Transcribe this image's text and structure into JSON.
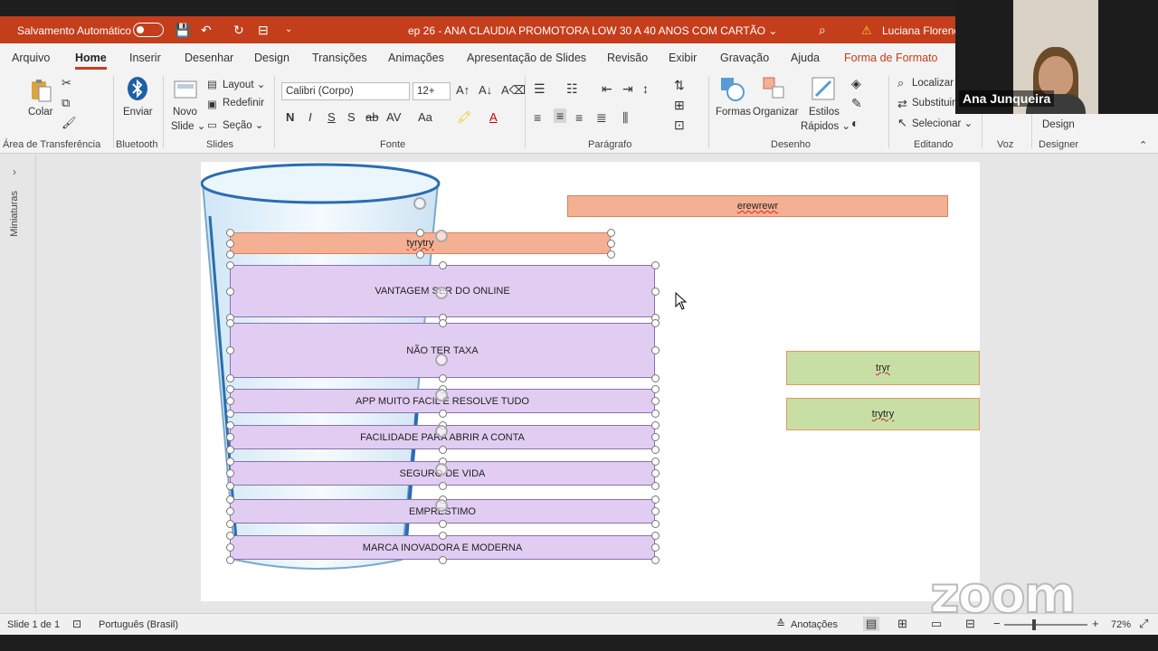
{
  "titlebar": {
    "autosave_label": "Salvamento Automático",
    "doc_title": "ep 26 - ANA CLAUDIA   PROMOTORA LOW  30 A 40 ANOS   COM CARTÃO  ⌄",
    "user_name": "Luciana Florenci"
  },
  "tabs": [
    "Arquivo",
    "Home",
    "Inserir",
    "Desenhar",
    "Design",
    "Transições",
    "Animações",
    "Apresentação de Slides",
    "Revisão",
    "Exibir",
    "Gravação",
    "Ajuda",
    "Forma de Formato"
  ],
  "ribbon": {
    "colar": "Colar",
    "enviar": "Enviar",
    "novo_slide": "Novo",
    "novo_slide2": "Slide ⌄",
    "layout": "Layout ⌄",
    "redefinir": "Redefinir",
    "secao": "Seção ⌄",
    "font_name": "Calibri (Corpo)",
    "font_size": "12+",
    "formas": "Formas",
    "organizar": "Organizar",
    "estilos": "Estilos",
    "rapidos": "Rápidos ⌄",
    "localizar": "Localizar",
    "substituir": "Substituir",
    "selecionar": "Selecionar ⌄",
    "design": "Design",
    "groups": {
      "clipboard": "Área de Transferência",
      "bluetooth": "Bluetooth",
      "slides": "Slides",
      "fonte": "Fonte",
      "paragrafo": "Parágrafo",
      "desenho": "Desenho",
      "editando": "Editando",
      "voz": "Voz",
      "designer": "Designer"
    }
  },
  "leftpanel": {
    "label": "Miniaturas"
  },
  "slide": {
    "top_bar": "erewrewr",
    "selected_bar": "tyrytry",
    "items": [
      "VANTAGEM SER DO ONLINE",
      "NÃO TER TAXA",
      "APP MUITO FACIL E RESOLVE TUDO",
      "FACILIDADE PARA ABRIR A CONTA",
      "SEGURO DE VIDA",
      "EMPRESTIMO",
      "MARCA INOVADORA E MODERNA"
    ],
    "green1": "tryr",
    "green2": "trytry"
  },
  "statusbar": {
    "slide_info": "Slide 1 de 1",
    "language": "Português (Brasil)",
    "notes": "Anotações",
    "zoom": "72%"
  },
  "video": {
    "participant": "Ana Junqueira"
  },
  "watermark": "zoom",
  "colors": {
    "accent": "#c43e1c",
    "purple_fill": "#e2cdf2",
    "salmon_fill": "#f4b093",
    "green_fill": "#c7dfa5"
  }
}
